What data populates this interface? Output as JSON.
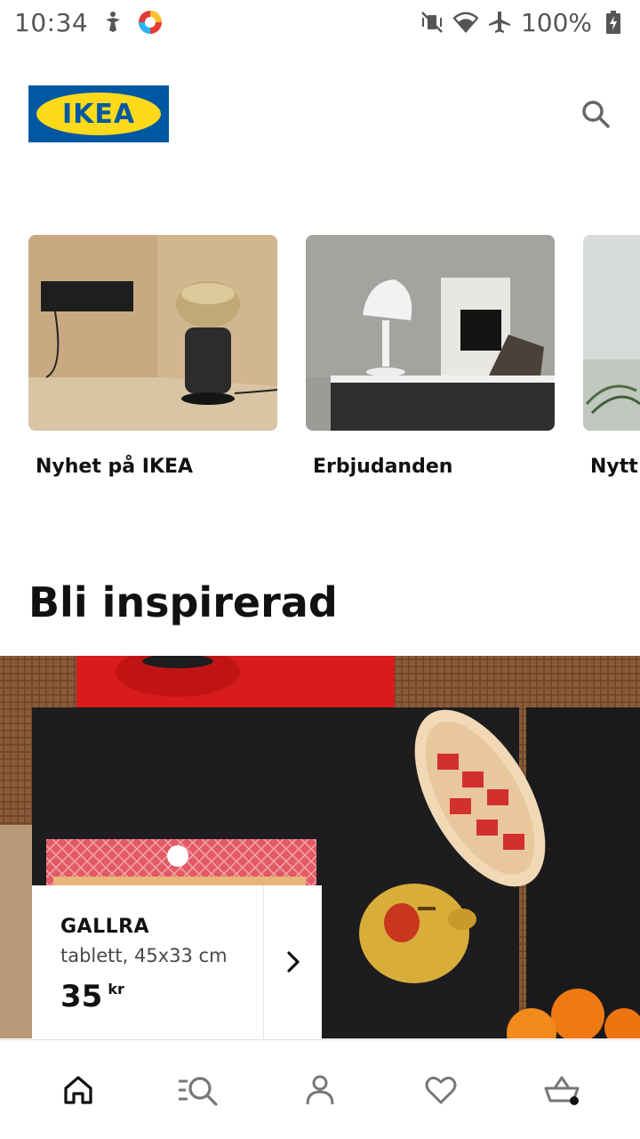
{
  "status_bar": {
    "time": "10:34",
    "battery": "100%"
  },
  "header": {
    "logo_text": "IKEA",
    "brand_colors": {
      "blue": "#0058a3",
      "yellow": "#ffda1a"
    }
  },
  "categories": [
    {
      "label": "Nyhet på IKEA"
    },
    {
      "label": "Erbjudanden"
    },
    {
      "label": "Nytt"
    }
  ],
  "section": {
    "title": "Bli inspirerad"
  },
  "product": {
    "name": "GALLRA",
    "description": "tablett, 45x33 cm",
    "price": "35",
    "currency": "kr"
  },
  "bottom_nav": {
    "items": [
      "home-icon",
      "browse-search-icon",
      "profile-icon",
      "favorites-heart-icon",
      "shopping-basket-icon"
    ]
  }
}
